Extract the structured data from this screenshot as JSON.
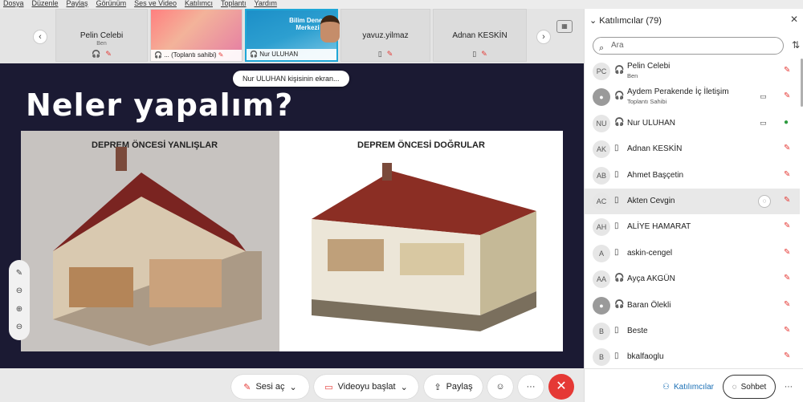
{
  "menu": [
    "Dosya",
    "Düzenle",
    "Paylaş",
    "Görünüm",
    "Ses ve Video",
    "Katılımcı",
    "Toplantı",
    "Yardım"
  ],
  "tiles": [
    {
      "name": "Pelin Celebi",
      "sub": "Ben"
    },
    {
      "caption": "... (Toplantı sahibi)"
    },
    {
      "caption": "Nur ULUHAN",
      "logo": "Bilim Deney Merkezi"
    },
    {
      "name": "yavuz.yilmaz"
    },
    {
      "name": "Adnan KESKİN"
    }
  ],
  "sharing_banner": "Nur ULUHAN kişisinin ekran...",
  "slide": {
    "title": "Neler yapalım?",
    "left_title": "DEPREM ÖNCESİ YANLIŞLAR",
    "right_title": "DEPREM ÖNCESİ DOĞRULAR"
  },
  "toolbar": {
    "unmute": "Sesi aç",
    "start_video": "Videoyu başlat",
    "share": "Paylaş",
    "more": "···",
    "leave": "✕"
  },
  "sidebar": {
    "title": "Katılımcılar (79)",
    "search_placeholder": "Ara",
    "participants": [
      {
        "initials": "PC",
        "name": "Pelin Celebi",
        "sub": "Ben"
      },
      {
        "initials": "",
        "name": "Aydem Perakende İç İletişim",
        "sub": "Toplantı Sahibi"
      },
      {
        "initials": "NU",
        "name": "Nur ULUHAN"
      },
      {
        "initials": "AK",
        "name": "Adnan KESKİN"
      },
      {
        "initials": "AB",
        "name": "Ahmet Başçetin"
      },
      {
        "initials": "AC",
        "name": "Akten Cevgin"
      },
      {
        "initials": "AH",
        "name": "ALİYE HAMARAT"
      },
      {
        "initials": "A",
        "name": "askin-cengel"
      },
      {
        "initials": "AA",
        "name": "Ayça AKGÜN"
      },
      {
        "initials": "",
        "name": "Baran Ölekli"
      },
      {
        "initials": "B",
        "name": "Beste"
      },
      {
        "initials": "B",
        "name": "bkalfaoglu"
      }
    ],
    "participants_btn": "Katılımcılar",
    "chat_btn": "Sohbet"
  },
  "colors": {
    "accent": "#1fa7d7",
    "mute": "#e53935",
    "leave": "#e53935",
    "slide_bg": "#1b1a33"
  }
}
